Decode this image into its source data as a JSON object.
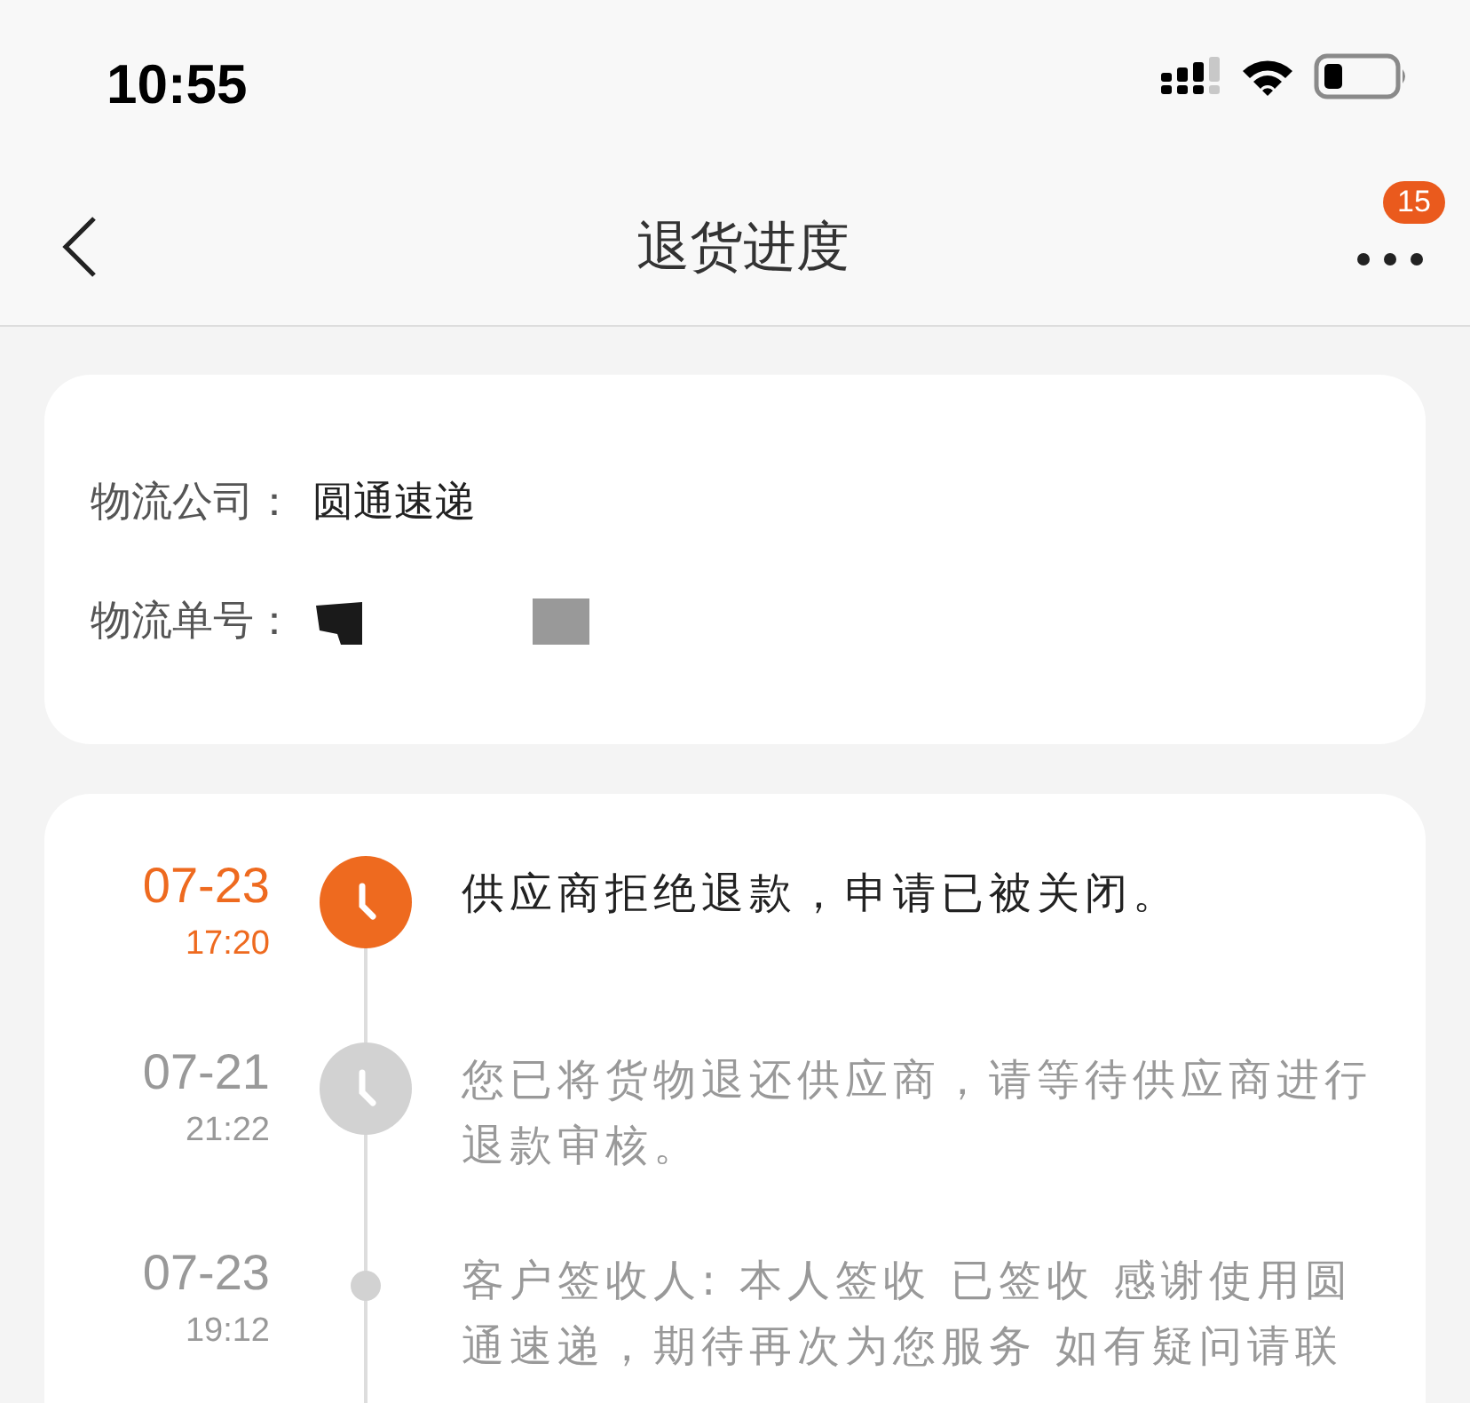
{
  "status_bar": {
    "time": "10:55"
  },
  "nav": {
    "title": "退货进度",
    "badge": "15"
  },
  "logistics": {
    "company_label": "物流公司：",
    "company": "圆通速递",
    "number_label": "物流单号："
  },
  "timeline": [
    {
      "date": "07-23",
      "time": "17:20",
      "kind": "clock",
      "active": true,
      "text": "供应商拒绝退款，申请已被关闭。"
    },
    {
      "date": "07-21",
      "time": "21:22",
      "kind": "clock",
      "active": false,
      "text": "您已将货物退还供应商，请等待供应商进行退款审核。"
    },
    {
      "date": "07-23",
      "time": "19:12",
      "kind": "dot",
      "active": false,
      "text": "客户签收人: 本人签收 已签收 感谢使用圆通速递，期待再次为您服务 如有疑问请联"
    }
  ]
}
